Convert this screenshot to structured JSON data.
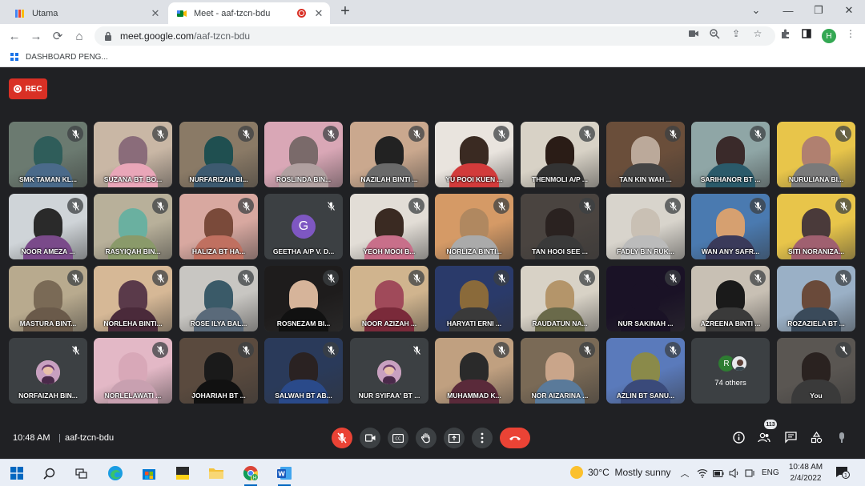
{
  "browser": {
    "tabs": [
      {
        "title": "Utama",
        "active": false
      },
      {
        "title": "Meet - aaf-tzcn-bdu",
        "active": true
      }
    ],
    "url_host": "meet.google.com",
    "url_path": "/aaf-tzcn-bdu",
    "profile_initial": "H",
    "bookmark": "DASHBOARD PENG..."
  },
  "meet": {
    "rec_label": "REC",
    "time": "10:48 AM",
    "separator": "|",
    "meeting_code": "aaf-tzcn-bdu",
    "participants_count": "113",
    "others_initial": "R",
    "others_label": "74 others",
    "participants": [
      {
        "name": "SMK TAMAN KL...",
        "kind": "video"
      },
      {
        "name": "SUZANA BT. BO...",
        "kind": "video"
      },
      {
        "name": "NURFARIZAH BI...",
        "kind": "video"
      },
      {
        "name": "ROSLINDA BIN...",
        "kind": "video"
      },
      {
        "name": "NAZILAH BINTI ...",
        "kind": "video"
      },
      {
        "name": "YU POOI KUEN ...",
        "kind": "video"
      },
      {
        "name": "THENMOLI A/P ...",
        "kind": "video"
      },
      {
        "name": "TAN KIN WAH ...",
        "kind": "video"
      },
      {
        "name": "SARIHANOR BT ...",
        "kind": "video"
      },
      {
        "name": "NURULIANA BI...",
        "kind": "video"
      },
      {
        "name": "NOOR AMEZA ...",
        "kind": "video"
      },
      {
        "name": "RASYIQAH BIN...",
        "kind": "video"
      },
      {
        "name": "HALIZA BT HA...",
        "kind": "video"
      },
      {
        "name": "GEETHA A/P V. D...",
        "kind": "initial",
        "initial": "G"
      },
      {
        "name": "YEOH MOOI B...",
        "kind": "video"
      },
      {
        "name": "NORLIZA BINTI...",
        "kind": "video"
      },
      {
        "name": "TAN HOOI SEE ...",
        "kind": "video"
      },
      {
        "name": "FADLY BIN RUK...",
        "kind": "video"
      },
      {
        "name": "WAN ANY SAFR...",
        "kind": "video"
      },
      {
        "name": "SITI NORANIZA...",
        "kind": "video"
      },
      {
        "name": "MASTURA BINT...",
        "kind": "video"
      },
      {
        "name": "NORLEHA BINTI...",
        "kind": "video"
      },
      {
        "name": "ROSE ILYA BAL...",
        "kind": "video"
      },
      {
        "name": "ROSNEZAM BI...",
        "kind": "video"
      },
      {
        "name": "NOOR AZIZAH ...",
        "kind": "video"
      },
      {
        "name": "HARYATI ERNI ...",
        "kind": "video"
      },
      {
        "name": "RAUDATUN NA...",
        "kind": "video"
      },
      {
        "name": "NUR SAKINAH ...",
        "kind": "video"
      },
      {
        "name": "AZREENA BINTI ...",
        "kind": "video"
      },
      {
        "name": "ROZAZIELA BT ...",
        "kind": "video"
      },
      {
        "name": "NORFAIZAH BIN...",
        "kind": "avatar"
      },
      {
        "name": "NORLELAWATI ...",
        "kind": "video"
      },
      {
        "name": "JOHARIAH BT ...",
        "kind": "video"
      },
      {
        "name": "SALWAH BT AB...",
        "kind": "video"
      },
      {
        "name": "NUR SYIFAA' BT ...",
        "kind": "avatar"
      },
      {
        "name": "MUHAMMAD K...",
        "kind": "video"
      },
      {
        "name": "NOR AIZARINA ...",
        "kind": "video"
      },
      {
        "name": "AZLIN BT SANU...",
        "kind": "video"
      },
      {
        "name": "You",
        "kind": "video"
      }
    ]
  },
  "taskbar": {
    "weather_temp": "30°C",
    "weather_text": "Mostly sunny",
    "language": "ENG",
    "clock_time": "10:48 AM",
    "clock_date": "2/4/2022",
    "notification_count": "1"
  },
  "colors": {
    "meet_bg": "#202124",
    "tile_bg": "#3c4043",
    "red": "#ea4335",
    "rec_red": "#d93025",
    "chrome_tab_bar": "#dee1e6"
  }
}
